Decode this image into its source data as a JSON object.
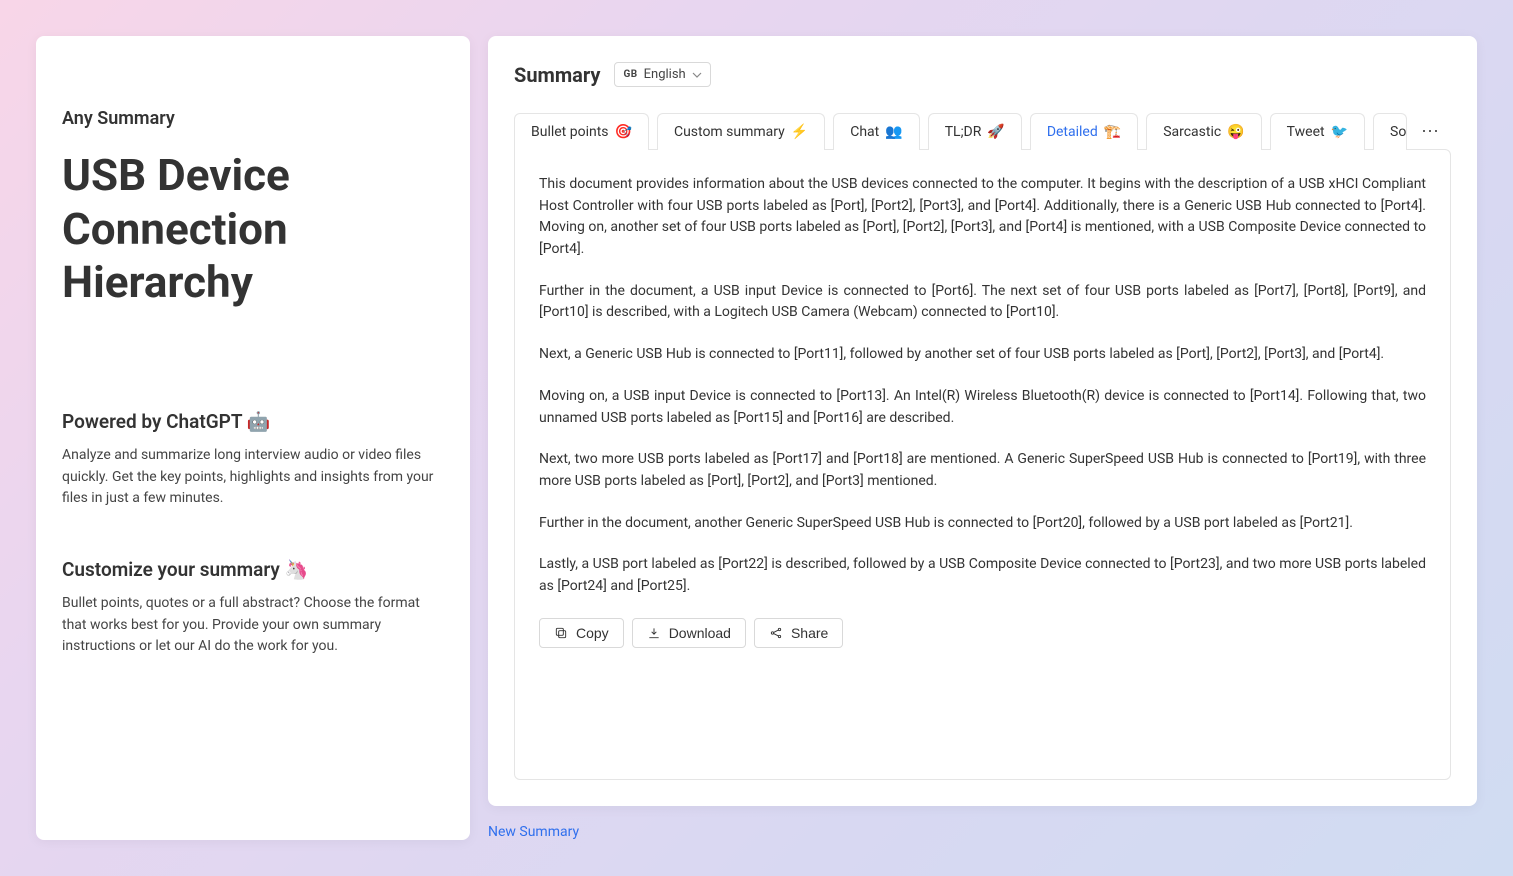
{
  "left": {
    "brand": "Any Summary",
    "title": "USB Device Connection Hierarchy",
    "section1_title": "Powered by ChatGPT 🤖",
    "section1_text": "Analyze and summarize long interview audio or video files quickly. Get the key points, highlights and insights from your files in just a few minutes.",
    "section2_title": "Customize your summary 🦄",
    "section2_text": "Bullet points, quotes or a full abstract? Choose the format that works best for you. Provide your own summary instructions or let our AI do the work for you."
  },
  "right": {
    "heading": "Summary",
    "language_flag": "GB",
    "language_label": "English",
    "tabs": [
      {
        "label": "Bullet points",
        "emoji": "🎯"
      },
      {
        "label": "Custom summary",
        "emoji": "⚡"
      },
      {
        "label": "Chat",
        "emoji": "👥"
      },
      {
        "label": "TL;DR",
        "emoji": "🚀"
      },
      {
        "label": "Detailed",
        "emoji": "🏗️",
        "active": true
      },
      {
        "label": "Sarcastic",
        "emoji": "😜"
      },
      {
        "label": "Tweet",
        "emoji": "🐦"
      },
      {
        "label": "So",
        "emoji": ""
      }
    ],
    "more": "⋯",
    "paragraphs": [
      "This document provides information about the USB devices connected to the computer. It begins with the description of a USB xHCI Compliant Host Controller with four USB ports labeled as [Port], [Port2], [Port3], and [Port4]. Additionally, there is a Generic USB Hub connected to [Port4]. Moving on, another set of four USB ports labeled as [Port], [Port2], [Port3], and [Port4] is mentioned, with a USB Composite Device connected to [Port4].",
      "Further in the document, a USB input Device is connected to [Port6]. The next set of four USB ports labeled as [Port7], [Port8], [Port9], and [Port10] is described, with a Logitech USB Camera (Webcam) connected to [Port10].",
      "Next, a Generic USB Hub is connected to [Port11], followed by another set of four USB ports labeled as [Port], [Port2], [Port3], and [Port4].",
      "Moving on, a USB input Device is connected to [Port13]. An Intel(R) Wireless Bluetooth(R) device is connected to [Port14]. Following that, two unnamed USB ports labeled as [Port15] and [Port16] are described.",
      "Next, two more USB ports labeled as [Port17] and [Port18] are mentioned. A Generic SuperSpeed USB Hub is connected to [Port19], with three more USB ports labeled as [Port], [Port2], and [Port3] mentioned.",
      "Further in the document, another Generic SuperSpeed USB Hub is connected to [Port20], followed by a USB port labeled as [Port21].",
      "Lastly, a USB port labeled as [Port22] is described, followed by a USB Composite Device connected to [Port23], and two more USB ports labeled as [Port24] and [Port25]."
    ],
    "actions": {
      "copy": "Copy",
      "download": "Download",
      "share": "Share"
    },
    "new_summary": "New Summary"
  }
}
